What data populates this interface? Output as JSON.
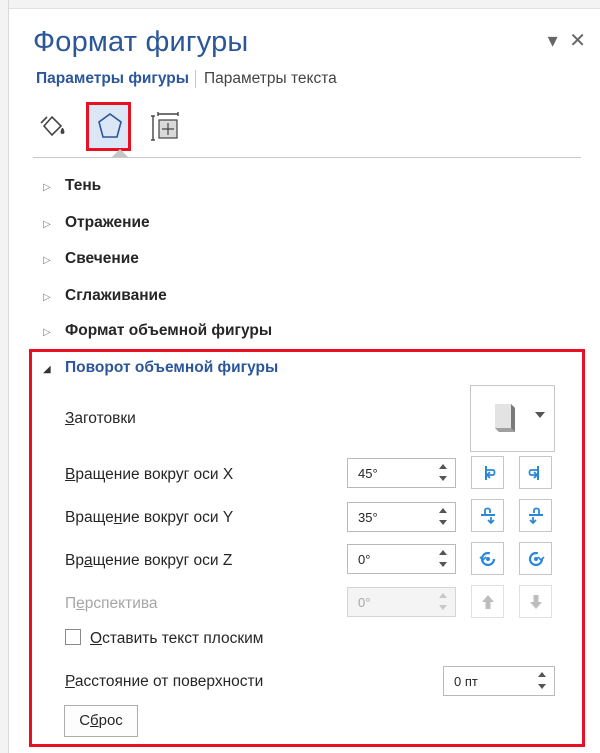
{
  "pane": {
    "title": "Формат фигуры",
    "controls": {
      "options_glyph": "▾",
      "close_glyph": "✕"
    }
  },
  "tabs": {
    "shape_options": "Параметры фигуры",
    "text_options": "Параметры текста"
  },
  "icon_tabs": [
    {
      "name": "fill-line-icon",
      "selected": false
    },
    {
      "name": "effects-pentagon-icon",
      "selected": true
    },
    {
      "name": "size-properties-icon",
      "selected": false
    }
  ],
  "sections": {
    "shadow": "Тень",
    "reflection": "Отражение",
    "glow": "Свечение",
    "soft_edges": "Сглаживание",
    "format_3d": "Формат объемной фигуры",
    "rotation_3d": "Поворот объемной фигуры"
  },
  "collapsed_glyph": "▷",
  "expanded_glyph": "◢",
  "rotation": {
    "presets": {
      "label_hotkey": "З",
      "label_rest": "аготовки"
    },
    "x": {
      "label_hotkey": "В",
      "label_rest": "ращение вокруг оси X",
      "value": "45°"
    },
    "y": {
      "label_pre": "Враще",
      "label_hotkey": "н",
      "label_rest": "ие вокруг оси Y",
      "value": "35°"
    },
    "z": {
      "label_pre": "Вр",
      "label_hotkey": "а",
      "label_rest": "щение вокруг оси Z",
      "value": "0°"
    },
    "perspective": {
      "label_pre": "П",
      "label_hotkey": "е",
      "label_rest": "рспектива",
      "value": "0°"
    },
    "keep_text_flat": {
      "label_hotkey": "О",
      "label_rest": "ставить текст плоским",
      "checked": false
    },
    "distance": {
      "label_hotkey": "Р",
      "label_rest": "асстояние от поверхности",
      "value": "0 пт"
    },
    "reset": {
      "label_pre": "С",
      "label_hotkey": "б",
      "label_rest": "рос"
    }
  },
  "colors": {
    "accent": "#2b579a",
    "highlight": "#e81123",
    "rotate_icon": "#2b88d8"
  }
}
